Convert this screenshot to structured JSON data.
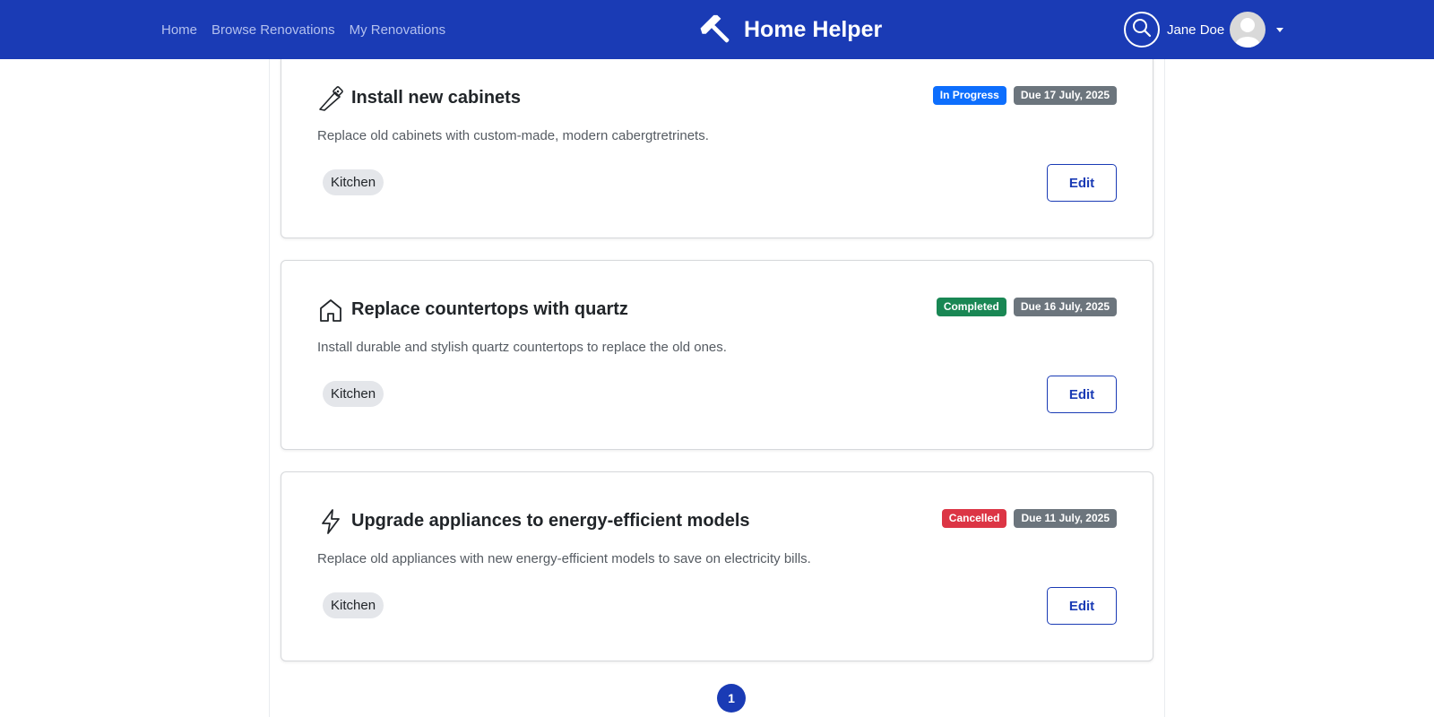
{
  "nav": {
    "links": [
      "Home",
      "Browse Renovations",
      "My Renovations"
    ],
    "brand": "Home Helper",
    "brand_icon": "hammer-icon",
    "user_name": "Jane Doe"
  },
  "colors": {
    "navbar": "#1a3bb5",
    "in_progress": "#0d6efd",
    "completed": "#198754",
    "cancelled": "#dc3545",
    "due": "#6c757d"
  },
  "renovations": [
    {
      "icon": "saw-icon",
      "title": "Install new cabinets",
      "description": "Replace old cabinets with custom-made, modern cabergtretrinets.",
      "status": "In Progress",
      "due": "Due 17 July, 2025",
      "tag": "Kitchen",
      "edit_label": "Edit"
    },
    {
      "icon": "house-icon",
      "title": "Replace countertops with quartz",
      "description": "Install durable and stylish quartz countertops to replace the old ones.",
      "status": "Completed",
      "due": "Due 16 July, 2025",
      "tag": "Kitchen",
      "edit_label": "Edit"
    },
    {
      "icon": "lightning-icon",
      "title": "Upgrade appliances to energy-efficient models",
      "description": "Replace old appliances with new energy-efficient models to save on electricity bills.",
      "status": "Cancelled",
      "due": "Due 11 July, 2025",
      "tag": "Kitchen",
      "edit_label": "Edit"
    }
  ],
  "pagination": {
    "current_page": "1"
  }
}
